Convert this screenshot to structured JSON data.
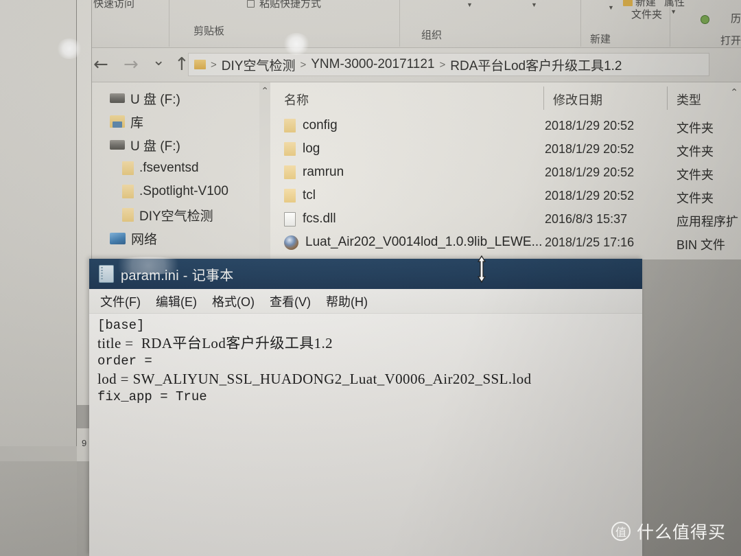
{
  "window_explorer": {
    "ribbon": {
      "quick_access": "快速访问",
      "paste_shortcut": "粘贴快捷方式",
      "new_folder": "新建\n文件夹",
      "new_folder_line1": "新建",
      "new_folder_line2": "文件夹",
      "properties": "属性",
      "history": "历",
      "groups": {
        "clipboard": "剪贴板",
        "organize": "组织",
        "new": "新建",
        "open": "打开"
      }
    },
    "navigation": {
      "back_icon": "arrow-left-icon",
      "forward_icon": "arrow-right-icon",
      "recent_icon": "chevron-down-icon",
      "up_icon": "arrow-up-icon",
      "back": "←",
      "forward": "→",
      "recent": "⌄",
      "up": "↑"
    },
    "breadcrumb": {
      "separator": ">",
      "items": [
        {
          "label": "DIY空气检测"
        },
        {
          "label": "YNM-3000-20171121"
        },
        {
          "label": "RDA平台Lod客户升级工具1.2"
        }
      ]
    },
    "sidebar": {
      "items": [
        {
          "label": "U 盘 (F:)",
          "icon": "drive-icon",
          "indent": false
        },
        {
          "label": "库",
          "icon": "library-icon",
          "indent": false
        },
        {
          "label": "U 盘 (F:)",
          "icon": "drive-icon",
          "indent": false
        },
        {
          "label": ".fseventsd",
          "icon": "folder-icon",
          "indent": true
        },
        {
          "label": ".Spotlight-V100",
          "icon": "folder-icon",
          "indent": true
        },
        {
          "label": "DIY空气检测",
          "icon": "folder-icon",
          "indent": true
        },
        {
          "label": "网络",
          "icon": "network-icon",
          "indent": false
        }
      ],
      "scroll_caret": "⌃"
    },
    "file_list": {
      "columns": {
        "name": "名称",
        "modified": "修改日期",
        "type": "类型"
      },
      "sort_caret": "⌃",
      "rows": [
        {
          "name": "config",
          "modified": "2018/1/29 20:52",
          "type": "文件夹",
          "icon": "folder-icon"
        },
        {
          "name": "log",
          "modified": "2018/1/29 20:52",
          "type": "文件夹",
          "icon": "folder-icon"
        },
        {
          "name": "ramrun",
          "modified": "2018/1/29 20:52",
          "type": "文件夹",
          "icon": "folder-icon"
        },
        {
          "name": "tcl",
          "modified": "2018/1/29 20:52",
          "type": "文件夹",
          "icon": "folder-icon"
        },
        {
          "name": "fcs.dll",
          "modified": "2016/8/3 15:37",
          "type": "应用程序扩",
          "icon": "dll-file-icon"
        },
        {
          "name": "Luat_Air202_V0014lod_1.0.9lib_LEWE...",
          "modified": "2018/1/25 17:16",
          "type": "BIN 文件",
          "icon": "bin-file-icon"
        }
      ]
    }
  },
  "window_notepad": {
    "title": "param.ini - 记事本",
    "icon": "notepad-icon",
    "menu": [
      {
        "label": "文件(F)"
      },
      {
        "label": "编辑(E)"
      },
      {
        "label": "格式(O)"
      },
      {
        "label": "查看(V)"
      },
      {
        "label": "帮助(H)"
      }
    ],
    "text_lines": [
      "[base]",
      "title =  RDA平台Lod客户升级工具1.2",
      "order =",
      "lod = SW_ALIYUN_SSL_HUADONG2_Luat_V0006_Air202_SSL.lod",
      "fix_app = True"
    ]
  },
  "background_window": {
    "partial_text": "9"
  },
  "cursor": {
    "type": "vertical-resize"
  },
  "watermark": {
    "logo_char": "值",
    "text": "什么值得买"
  },
  "colors": {
    "notepad_titlebar": "#1d3a58",
    "desktop": "#bdbbb5",
    "folder_icon": "#e6c87f",
    "watermark_text": "#f4f4f2"
  }
}
